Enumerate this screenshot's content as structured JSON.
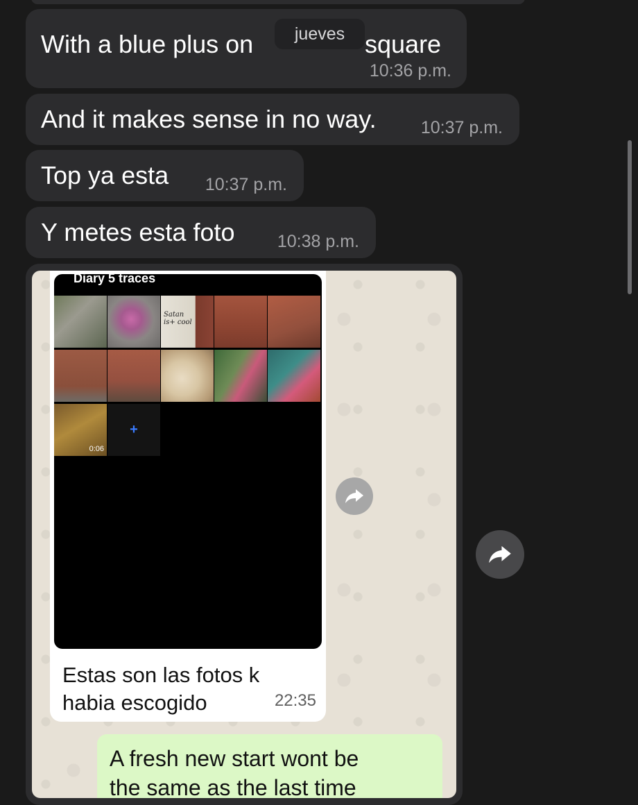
{
  "messages": [
    {
      "text": "With a blue plus on the square",
      "time": "10:36 p.m."
    },
    {
      "text": "And it makes sense in no way.",
      "time": "10:37 p.m."
    },
    {
      "text": "Top ya esta",
      "time": "10:37 p.m."
    },
    {
      "text": "Y metes esta foto",
      "time": "10:38 p.m."
    }
  ],
  "date_pill": "jueves",
  "first_message_visible": {
    "left": "With a blue plus on ",
    "right": "square"
  },
  "screenshot": {
    "phone_title": "Diary 5 traces",
    "grid_labels": {
      "satan_note": "Satan is+ cool",
      "video_duration": "0:06"
    },
    "add_symbol": "+",
    "caption_line1": "Estas son las fotos k",
    "caption_line2": "habia escogido",
    "caption_time": "22:35",
    "outgoing_line1": "A fresh new start wont be",
    "outgoing_line2": "the same as the last time"
  },
  "icons": {
    "share": "share-forward-icon",
    "add": "plus-icon"
  },
  "colors": {
    "background": "#1a1a1a",
    "bubble": "#2c2c2e",
    "timestamp": "#a3a3a6",
    "outgoing_green": "#dcf8c6",
    "plus_blue": "#3a7bff"
  }
}
